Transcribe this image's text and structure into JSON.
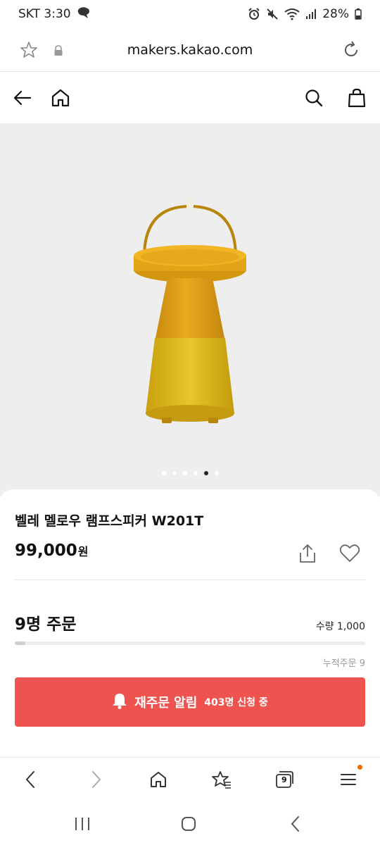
{
  "status_bar": {
    "carrier_time": "SKT 3:30",
    "battery": "28%",
    "icons": [
      "chat-bubble-icon",
      "alarm-icon",
      "mute-icon",
      "wifi-icon",
      "signal-icon",
      "battery-icon"
    ]
  },
  "browser": {
    "url": "makers.kakao.com",
    "icons": [
      "star-icon",
      "lock-icon",
      "reload-icon"
    ]
  },
  "site_nav": {
    "icons": [
      "back-arrow-icon",
      "home-icon",
      "search-icon",
      "shopping-bag-icon"
    ]
  },
  "product": {
    "title": "벨레 멜로우 램프스피커 W201T",
    "price": "99,000",
    "currency": "원",
    "image_icon": "lamp-speaker-image",
    "carousel": {
      "count": 6,
      "active_index": 4
    }
  },
  "orders": {
    "count_label": "9명 주문",
    "quantity_label": "수량 1,000",
    "progress_fraction": 0.009,
    "cumulative_label": "누적주문 9"
  },
  "restock": {
    "label": "재주문 알림",
    "sub_label": "403명 신청 중",
    "color": "#ef5350",
    "icon": "bell-icon"
  },
  "browser_bottom": {
    "tab_count": "9",
    "icons": [
      "back-icon",
      "forward-icon",
      "home-icon",
      "bookmarks-icon",
      "tabs-icon",
      "menu-icon"
    ],
    "notification_color": "#ef6c00"
  },
  "system_nav": {
    "icons": [
      "recent-apps-icon",
      "home-button-icon",
      "back-icon"
    ]
  }
}
